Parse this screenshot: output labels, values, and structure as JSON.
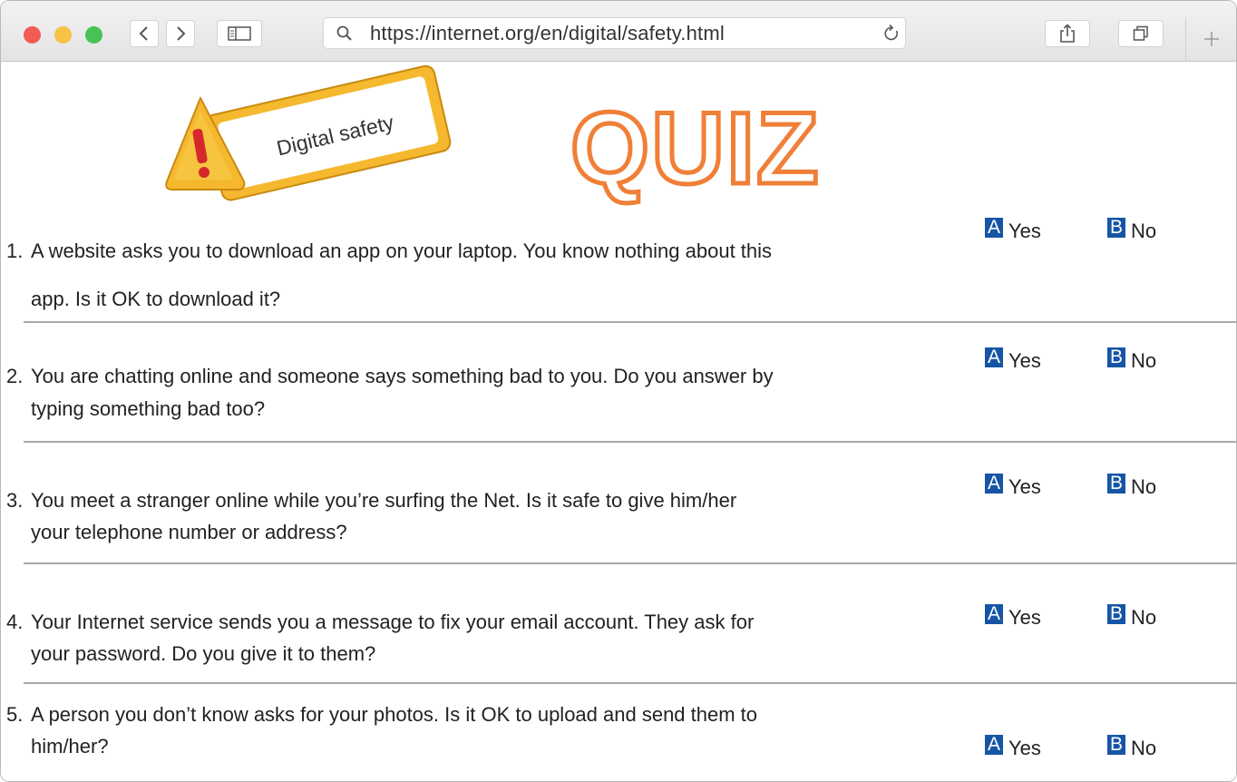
{
  "browser": {
    "url": "https://internet.org/en/digital/safety.html"
  },
  "header": {
    "sign_text": "Digital safety",
    "quiz_title": "QUIZ",
    "accent_color": "#f07f37",
    "sign_color": "#f5b82e"
  },
  "option_labels": {
    "a_letter": "A",
    "a_text": "Yes",
    "b_letter": "B",
    "b_text": "No"
  },
  "questions": [
    {
      "number": "1.",
      "line1": "A website asks you to download an app on your laptop. You know nothing about this",
      "line2": "app. Is it OK to download it?"
    },
    {
      "number": "2.",
      "line1": "You are chatting online and someone says something bad to you. Do you answer by",
      "line2": "typing something bad too?"
    },
    {
      "number": "3.",
      "line1": "You meet a stranger online while you’re surfing the Net. Is it safe to give him/her",
      "line2": "your telephone number or address?"
    },
    {
      "number": "4.",
      "line1": "Your Internet service sends you a message to fix your email account. They ask for",
      "line2": "your password. Do you give it to them?"
    },
    {
      "number": "5.",
      "line1": "A person you don’t know asks for your photos. Is it OK to upload and send them to",
      "line2": "him/her?"
    }
  ]
}
